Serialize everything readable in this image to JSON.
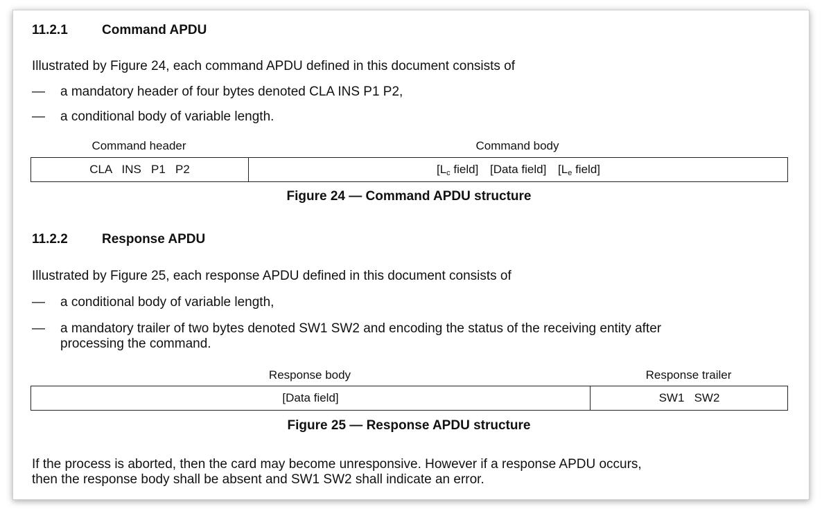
{
  "section1": {
    "number": "11.2.1",
    "title": "Command APDU",
    "intro": "Illustrated by Figure 24, each command APDU defined in this document consists of",
    "bullets": [
      {
        "dash": "—",
        "text": "a mandatory header of four bytes denoted CLA INS P1 P2,"
      },
      {
        "dash": "—",
        "text": "a conditional body of variable length."
      }
    ],
    "figure": {
      "header_label": "Command header",
      "body_label": "Command body",
      "header_cell": "CLA   INS   P1   P2",
      "body_fields": {
        "lc_open": "[L",
        "lc_sub": "c",
        "lc_close": " field]",
        "data": "[Data field]",
        "le_open": "[L",
        "le_sub": "e",
        "le_close": " field]"
      },
      "caption": "Figure 24 — Command APDU structure"
    }
  },
  "section2": {
    "number": "11.2.2",
    "title": "Response APDU",
    "intro": "Illustrated by Figure 25, each response APDU defined in this document consists of",
    "bullets": [
      {
        "dash": "—",
        "text": "a conditional body of variable length,"
      },
      {
        "dash": "—",
        "text": "a mandatory trailer of two bytes denoted SW1 SW2 and encoding the status of the receiving entity after",
        "text2": "processing the command."
      }
    ],
    "figure": {
      "body_label": "Response body",
      "trailer_label": "Response trailer",
      "body_cell": "[Data field]",
      "trailer_cell": "SW1   SW2",
      "caption": "Figure 25 — Response APDU structure"
    }
  },
  "closing": {
    "line1": "If the process is aborted, then the card may become unresponsive.  However if a response APDU occurs,",
    "line2": "then the response body shall be absent and SW1 SW2 shall indicate an error."
  }
}
